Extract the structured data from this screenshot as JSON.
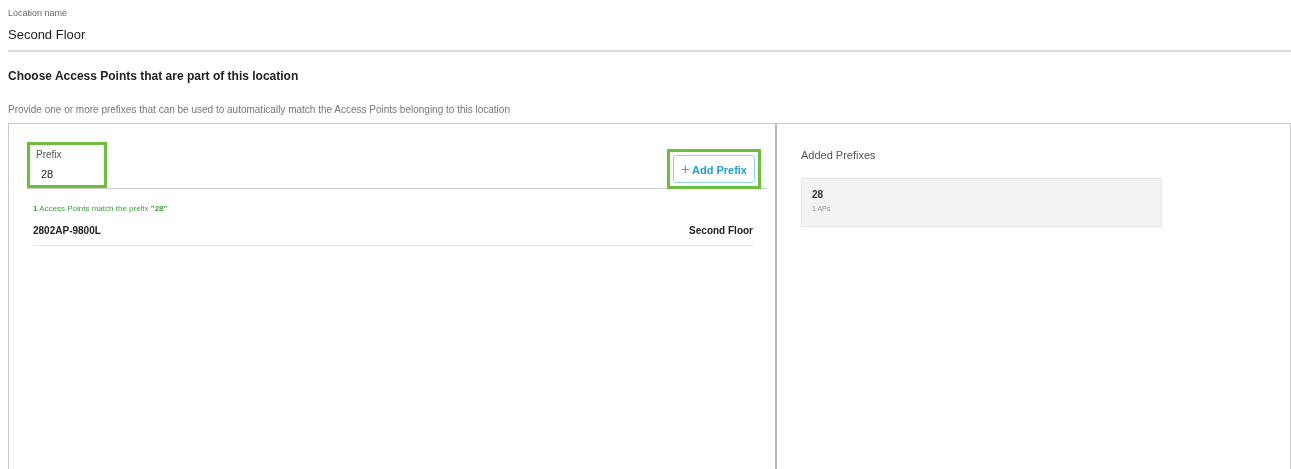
{
  "location_name": {
    "label": "Location name",
    "value": "Second Floor"
  },
  "section": {
    "title": "Choose Access Points that are part of this location",
    "description": "Provide one or more prefixes that can be used to automatically match the Access Points belonging to this location"
  },
  "prefix_field": {
    "label": "Prefix",
    "value": "28",
    "highlighted": true
  },
  "add_button": {
    "icon": "+",
    "label": "Add Prefix",
    "highlighted": true
  },
  "match_message": "**1** Access Points match the prefix **\"28\"**",
  "matches": [
    {
      "name": "2802AP-9800L",
      "location": "Second Floor"
    }
  ],
  "added_prefixes": {
    "title": "Added Prefixes",
    "items": [
      {
        "prefix": "28",
        "count": "1 APs"
      }
    ]
  }
}
